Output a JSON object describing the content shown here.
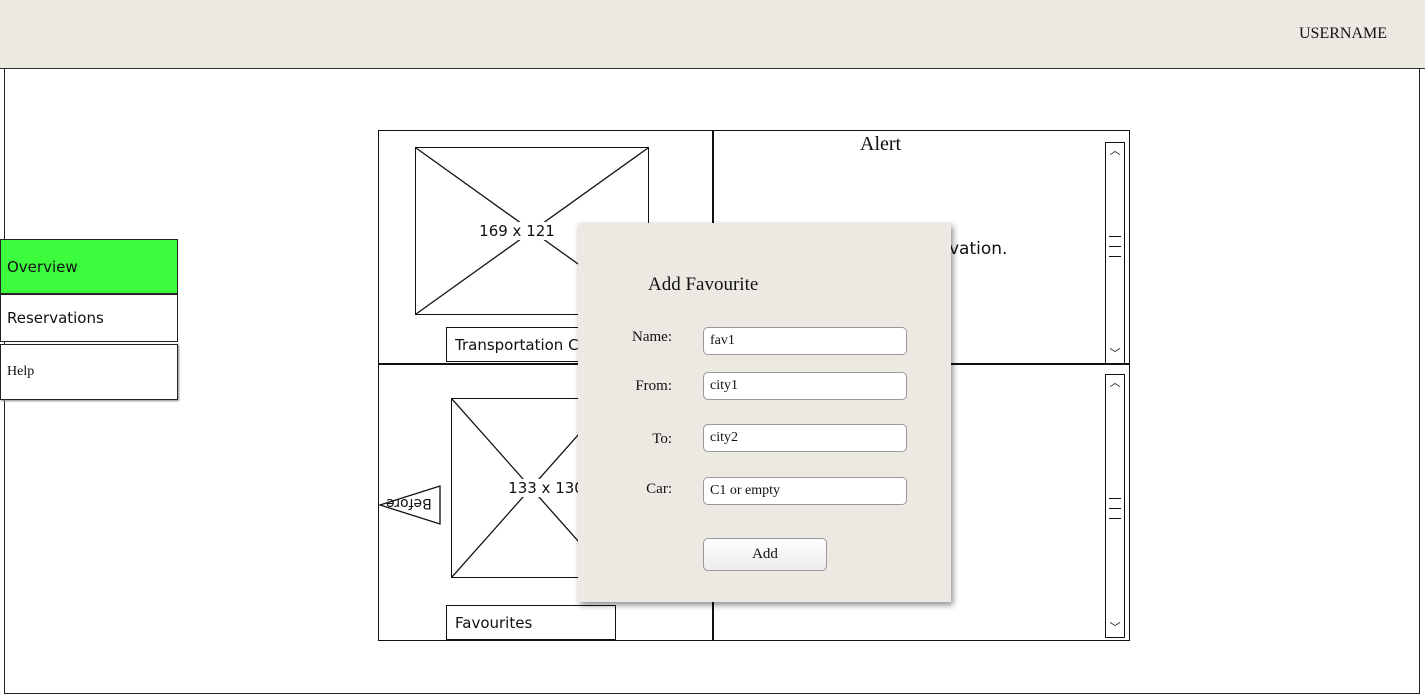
{
  "header": {
    "username": "USERNAME"
  },
  "sidebar": {
    "items": [
      {
        "label": "Overview"
      },
      {
        "label": "Reservations"
      },
      {
        "label": "Help"
      }
    ]
  },
  "panels": {
    "top_left": {
      "image_label": "169 x 121",
      "caption": "Transportation C"
    },
    "bottom_left": {
      "image_label": "133 x 130",
      "caption": "Favourites",
      "flag_label": "Before"
    },
    "top_right": {
      "title": "Alert",
      "text": "rvation."
    }
  },
  "dialog": {
    "title": "Add Favourite",
    "fields": [
      {
        "label": "Name:",
        "value": "fav1"
      },
      {
        "label": "From:",
        "value": "city1"
      },
      {
        "label": "To:",
        "value": "city2"
      },
      {
        "label": "Car:",
        "value": "C1 or empty"
      }
    ],
    "add_label": "Add"
  }
}
